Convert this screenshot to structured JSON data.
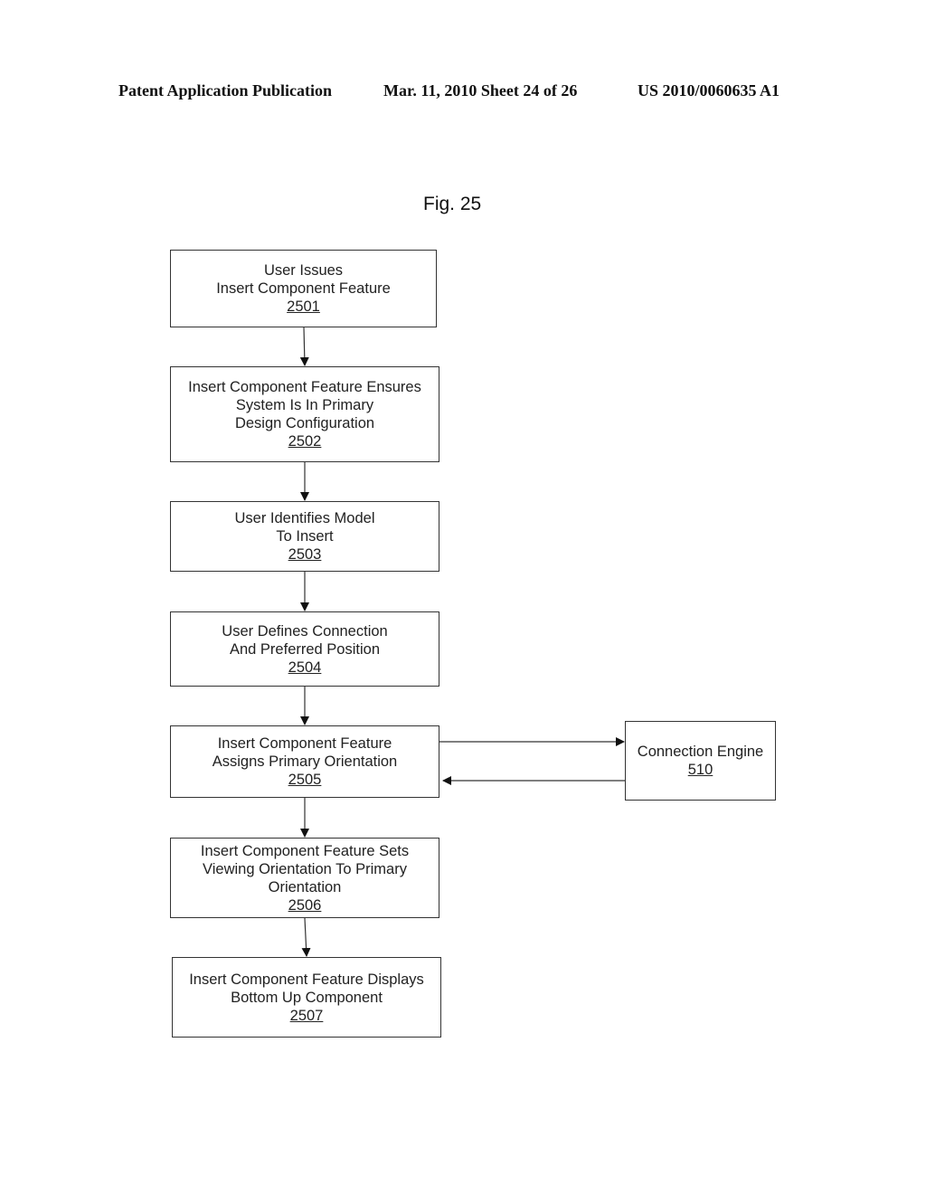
{
  "header": {
    "publication": "Patent Application Publication",
    "date_sheet": "Mar. 11, 2010  Sheet 24 of 26",
    "number": "US 2010/0060635 A1"
  },
  "figure": {
    "title": "Fig. 25",
    "steps": [
      {
        "lines": [
          "User Issues",
          "Insert Component Feature"
        ],
        "ref": "2501"
      },
      {
        "lines": [
          "Insert Component Feature Ensures",
          "System Is In Primary",
          "Design Configuration"
        ],
        "ref": "2502"
      },
      {
        "lines": [
          "User Identifies Model",
          "To Insert"
        ],
        "ref": "2503"
      },
      {
        "lines": [
          "User Defines Connection",
          "And Preferred Position"
        ],
        "ref": "2504"
      },
      {
        "lines": [
          "Insert Component Feature",
          "Assigns Primary Orientation"
        ],
        "ref": "2505"
      },
      {
        "lines": [
          "Insert Component Feature Sets",
          "Viewing Orientation To Primary",
          "Orientation"
        ],
        "ref": "2506"
      },
      {
        "lines": [
          "Insert Component Feature Displays",
          "Bottom Up Component"
        ],
        "ref": "2507"
      }
    ],
    "side_box": {
      "lines": [
        "Connection Engine"
      ],
      "ref": "510"
    },
    "edges": [
      {
        "from": "2501",
        "to": "2502"
      },
      {
        "from": "2502",
        "to": "2503"
      },
      {
        "from": "2503",
        "to": "2504"
      },
      {
        "from": "2504",
        "to": "2505"
      },
      {
        "from": "2505",
        "to": "510"
      },
      {
        "from": "510",
        "to": "2505"
      },
      {
        "from": "2505",
        "to": "2506"
      },
      {
        "from": "2506",
        "to": "2507"
      }
    ]
  }
}
